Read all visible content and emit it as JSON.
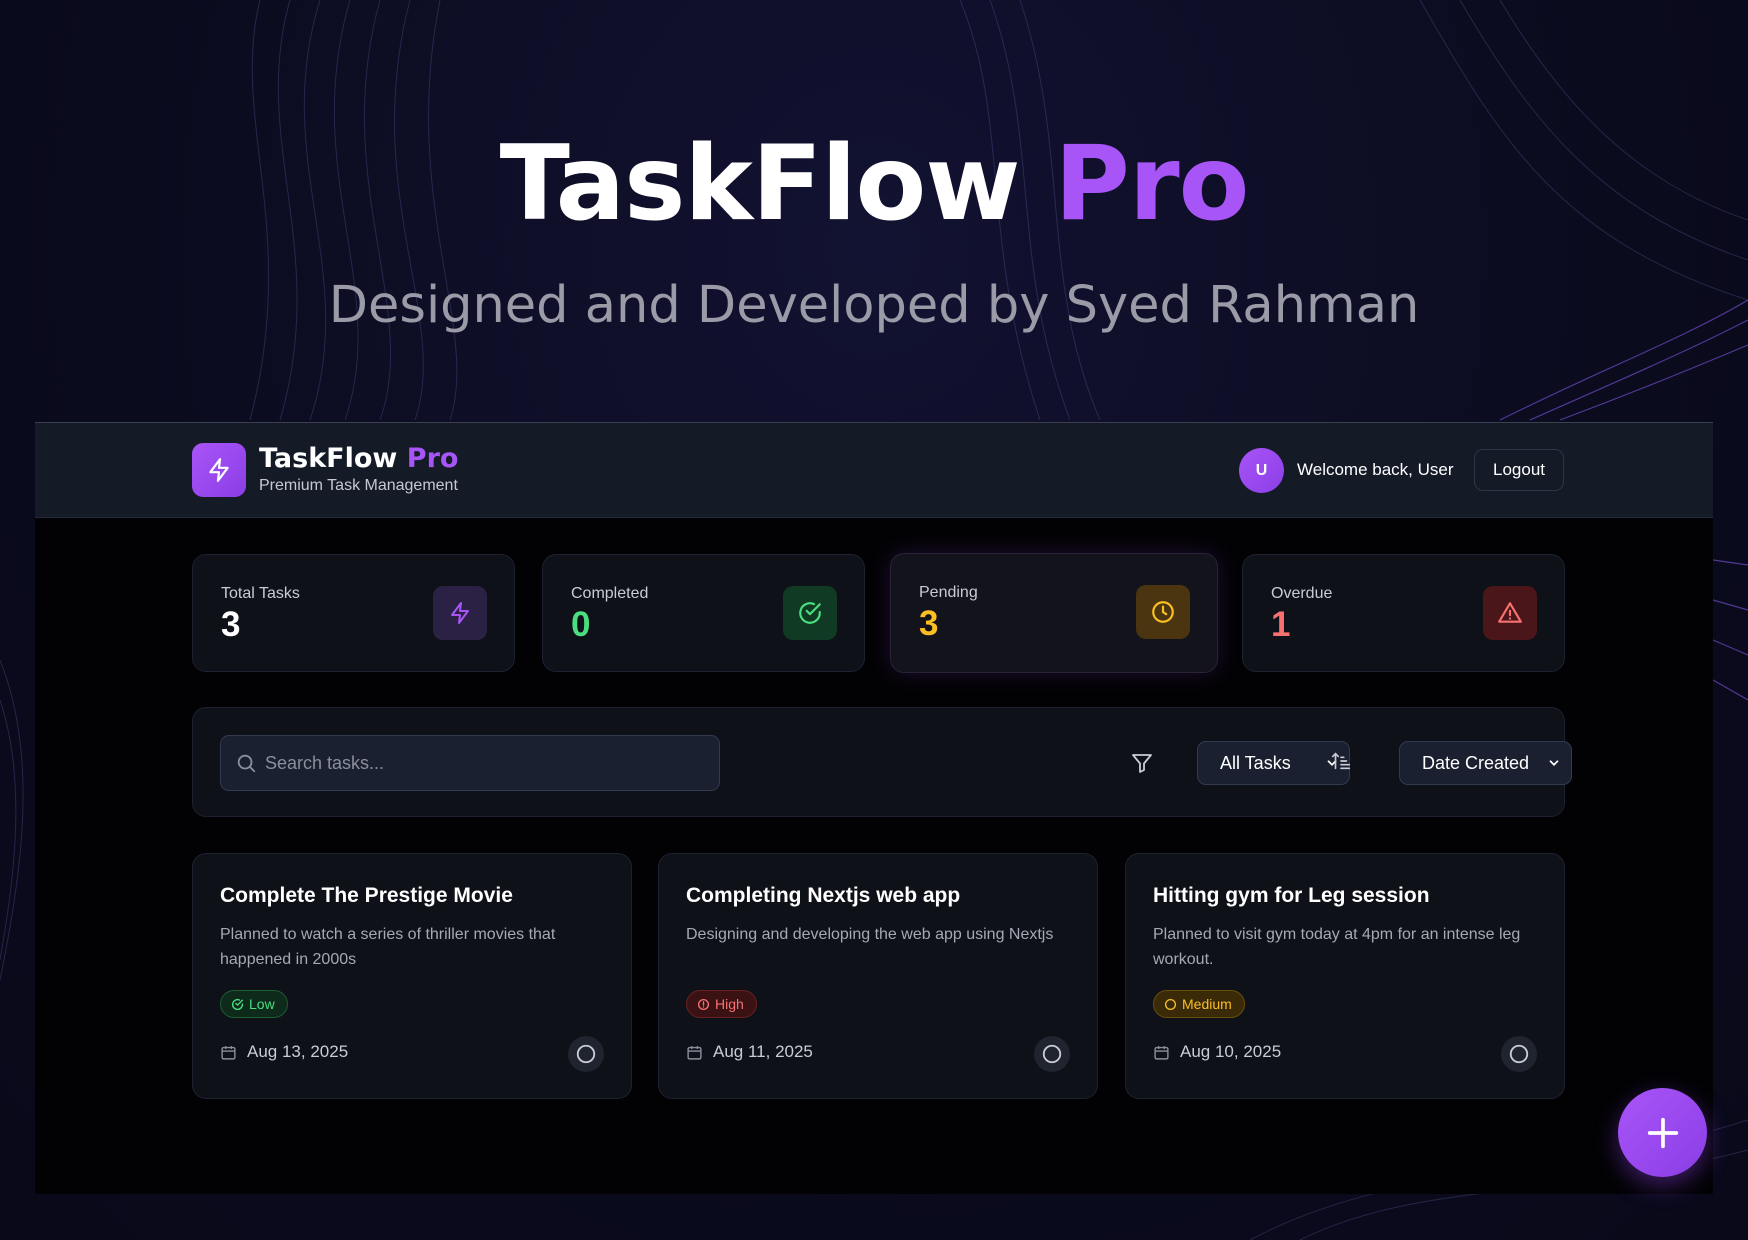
{
  "hero": {
    "title_main": "TaskFlow",
    "title_accent": "Pro",
    "subtitle": "Designed and Developed by Syed Rahman"
  },
  "header": {
    "brand_main": "TaskFlow",
    "brand_accent": "Pro",
    "tagline": "Premium Task Management",
    "avatar_initial": "U",
    "welcome": "Welcome back, User",
    "logout_label": "Logout"
  },
  "stats": [
    {
      "label": "Total Tasks",
      "value": "3",
      "color": "#ffffff",
      "icon": "lightning-icon"
    },
    {
      "label": "Completed",
      "value": "0",
      "color": "#4ade80",
      "icon": "check-circle-icon"
    },
    {
      "label": "Pending",
      "value": "3",
      "color": "#fbbf24",
      "icon": "clock-icon"
    },
    {
      "label": "Overdue",
      "value": "1",
      "color": "#f87171",
      "icon": "warning-icon"
    }
  ],
  "filters": {
    "search_placeholder": "Search tasks...",
    "status_selected": "All Tasks",
    "sort_selected": "Date Created"
  },
  "tasks": [
    {
      "title": "Complete The Prestige Movie",
      "description": "Planned to watch a series of thriller movies that happened in 2000s",
      "priority": "Low",
      "date": "Aug 13, 2025"
    },
    {
      "title": "Completing Nextjs web app",
      "description": "Designing and developing the web app using Nextjs",
      "priority": "High",
      "date": "Aug 11, 2025"
    },
    {
      "title": "Hitting gym for Leg session",
      "description": "Planned to visit gym today at 4pm for an intense leg workout.",
      "priority": "Medium",
      "date": "Aug 10, 2025"
    }
  ],
  "colors": {
    "accent": "#a855f7",
    "success": "#4ade80",
    "warning": "#fbbf24",
    "danger": "#f87171"
  }
}
